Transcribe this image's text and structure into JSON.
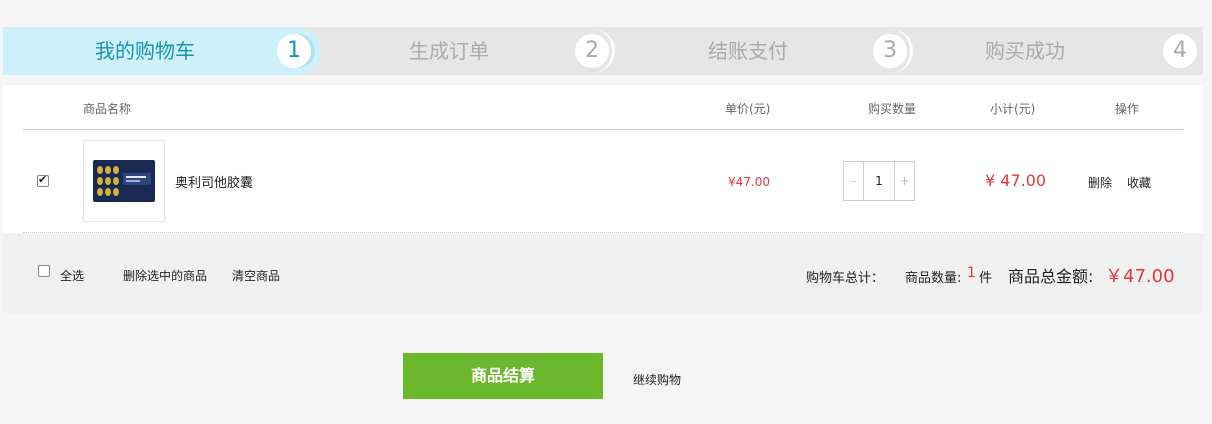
{
  "steps": [
    {
      "label": "我的购物车",
      "num": "1",
      "active": true
    },
    {
      "label": "生成订单",
      "num": "2",
      "active": false
    },
    {
      "label": "结账支付",
      "num": "3",
      "active": false
    },
    {
      "label": "购买成功",
      "num": "4",
      "active": false
    }
  ],
  "table": {
    "headers": {
      "name": "商品名称",
      "unit_price": "单价(元)",
      "qty": "购买数量",
      "subtotal": "小计(元)",
      "ops": "操作"
    }
  },
  "items": [
    {
      "checked": true,
      "name": "奥利司他胶囊",
      "unit_price": "¥47.00",
      "qty": "1",
      "qty_minus": "-",
      "qty_plus": "+",
      "subtotal": "¥ 47.00",
      "delete_label": "删除",
      "favorite_label": "收藏"
    }
  ],
  "footer": {
    "select_all": "全选",
    "delete_selected": "删除选中的商品",
    "clear_cart": "清空商品",
    "cart_total_label": "购物车总计：",
    "count_label": "商品数量:",
    "count": "1",
    "count_unit": "件",
    "amount_label": "商品总金额:",
    "amount": "￥47.00"
  },
  "actions": {
    "checkout": "商品结算",
    "continue": "继续购物"
  },
  "colors": {
    "accent": "#1596b6",
    "price_red": "#e4393c",
    "checkout_green": "#6cb82c"
  }
}
